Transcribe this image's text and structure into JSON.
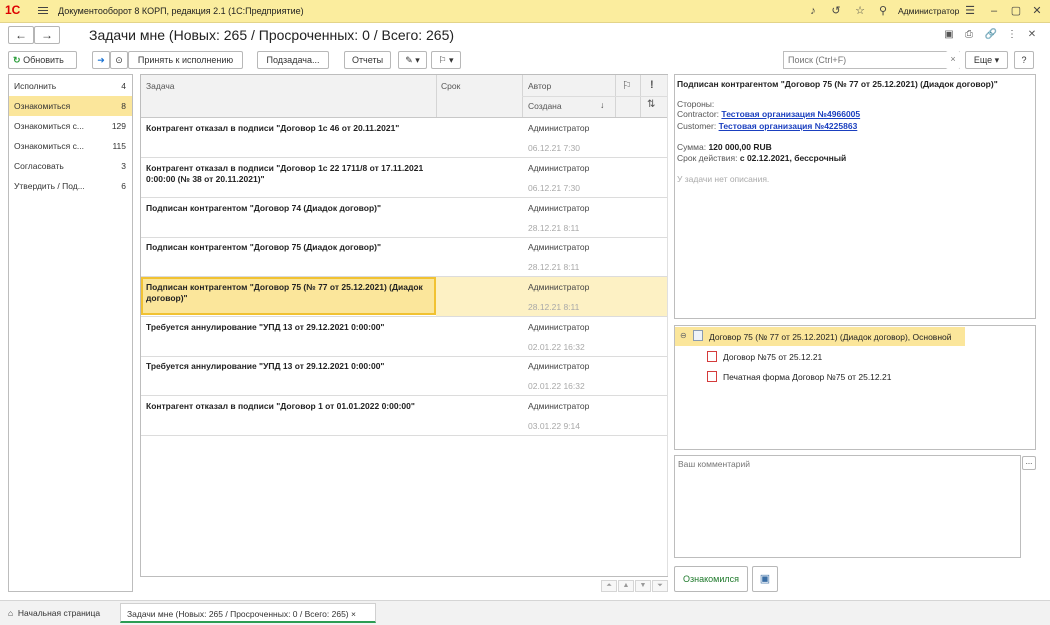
{
  "app": {
    "title": "Документооборот 8 КОРП, редакция 2.1  (1С:Предприятие)",
    "user": "Администратор"
  },
  "header": {
    "title": "Задачи мне (Новых: 265 / Просроченных: 0 / Всего: 265)"
  },
  "toolbar": {
    "refresh": "Обновить",
    "accept": "Принять к исполнению",
    "subtask": "Подзадача...",
    "reports": "Отчеты",
    "search_placeholder": "Поиск (Ctrl+F)",
    "more": "Еще",
    "help": "?",
    "clear": "×"
  },
  "filters": [
    {
      "label": "Исполнить",
      "count": "4"
    },
    {
      "label": "Ознакомиться",
      "count": "8"
    },
    {
      "label": "Ознакомиться с...",
      "count": "129"
    },
    {
      "label": "Ознакомиться с...",
      "count": "115"
    },
    {
      "label": "Согласовать",
      "count": "3"
    },
    {
      "label": "Утвердить / Под...",
      "count": "6"
    }
  ],
  "table": {
    "col_task": "Задача",
    "col_deadline": "Срок",
    "col_author": "Автор",
    "col_created": "Создана",
    "sort_arrow": "↓",
    "flag": "⚐",
    "important": "!"
  },
  "tasks": [
    {
      "title": "Контрагент отказал в подписи \"Договор 1с 46 от 20.11.2021\"",
      "author": "Администратор",
      "date": "06.12.21 7:30"
    },
    {
      "title": "Контрагент отказал в подписи \"Договор 1с 22 1711/8 от 17.11.2021 0:00:00 (№ 38 от 20.11.2021)\"",
      "author": "Администратор",
      "date": "06.12.21 7:30"
    },
    {
      "title": "Подписан контрагентом \"Договор 74 (Диадок договор)\"",
      "author": "Администратор",
      "date": "28.12.21 8:11"
    },
    {
      "title": "Подписан контрагентом \"Договор 75 (Диадок договор)\"",
      "author": "Администратор",
      "date": "28.12.21 8:11"
    },
    {
      "title": "Подписан контрагентом \"Договор 75 (№ 77 от 25.12.2021) (Диадок договор)\"",
      "author": "Администратор",
      "date": "28.12.21 8:11"
    },
    {
      "title": "Требуется аннулирование \"УПД 13 от 29.12.2021 0:00:00\"",
      "author": "Администратор",
      "date": "02.01.22 16:32"
    },
    {
      "title": "Требуется аннулирование \"УПД 13 от 29.12.2021 0:00:00\"",
      "author": "Администратор",
      "date": "02.01.22 16:32"
    },
    {
      "title": "Контрагент отказал в подписи \"Договор 1 от 01.01.2022 0:00:00\"",
      "author": "Администратор",
      "date": "03.01.22 9:14"
    }
  ],
  "details": {
    "title": "Подписан контрагентом \"Договор 75 (№ 77 от 25.12.2021) (Диадок договор)\"",
    "parties_label": "Стороны:",
    "contractor_label": "Contractor:",
    "contractor": "Тестовая организация №4966005",
    "customer_label": "Customer:",
    "customer": "Тестовая организация №4225863",
    "sum_label": "Сумма:",
    "sum": "120 000,00 RUB",
    "term_label": "Срок действия:",
    "term": "с 02.12.2021, бессрочный",
    "no_desc": "У задачи нет описания."
  },
  "attachments": {
    "root": "Договор 75 (№ 77 от 25.12.2021) (Диадок договор), Основной",
    "files": [
      "Договор №75 от 25.12.21",
      "Печатная форма Договор №75 от 25.12.21"
    ]
  },
  "comment": {
    "placeholder": "Ваш комментарий",
    "more": "..."
  },
  "actions": {
    "acknowledged": "Ознакомился"
  },
  "bottom": {
    "home": "Начальная страница",
    "tab": "Задачи мне (Новых: 265 / Просроченных: 0 / Всего: 265)",
    "close": "×"
  }
}
